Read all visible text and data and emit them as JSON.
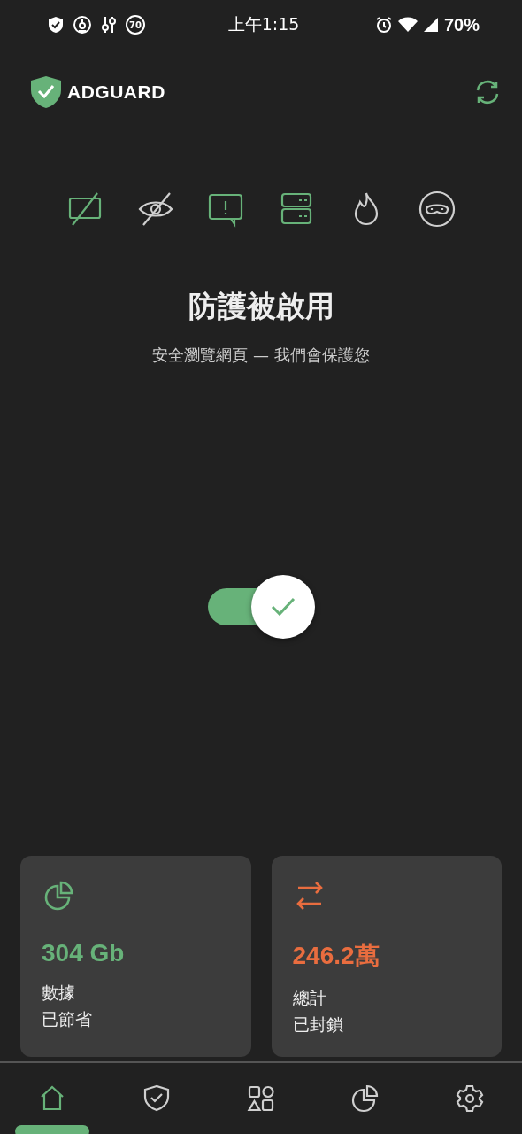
{
  "status_bar": {
    "time": "上午1:15",
    "battery": "70%",
    "badge": "70"
  },
  "header": {
    "logo": "ADGUARD"
  },
  "features": [
    {
      "kind": "ads",
      "on": true
    },
    {
      "kind": "tracking",
      "on": false
    },
    {
      "kind": "annoyance",
      "on": true
    },
    {
      "kind": "dns",
      "on": true
    },
    {
      "kind": "firewall",
      "on": false
    },
    {
      "kind": "stealth",
      "on": false
    }
  ],
  "status": {
    "title": "防護被啟用",
    "subtitle": "安全瀏覽網頁 — 我們會保護您"
  },
  "protection": {
    "on": true
  },
  "stats": [
    {
      "kind": "pie",
      "value": "304 Gb",
      "label_1": "數據",
      "label_2": "已節省",
      "color": "#67b279"
    },
    {
      "kind": "transfer",
      "value": "246.2萬",
      "label_1": "總計",
      "label_2": "已封鎖",
      "color": "#e96d3f"
    }
  ],
  "nav": [
    {
      "kind": "home",
      "selected": true
    },
    {
      "kind": "protection",
      "selected": false
    },
    {
      "kind": "apps",
      "selected": false
    },
    {
      "kind": "stats",
      "selected": false
    },
    {
      "kind": "settings",
      "selected": false
    }
  ]
}
